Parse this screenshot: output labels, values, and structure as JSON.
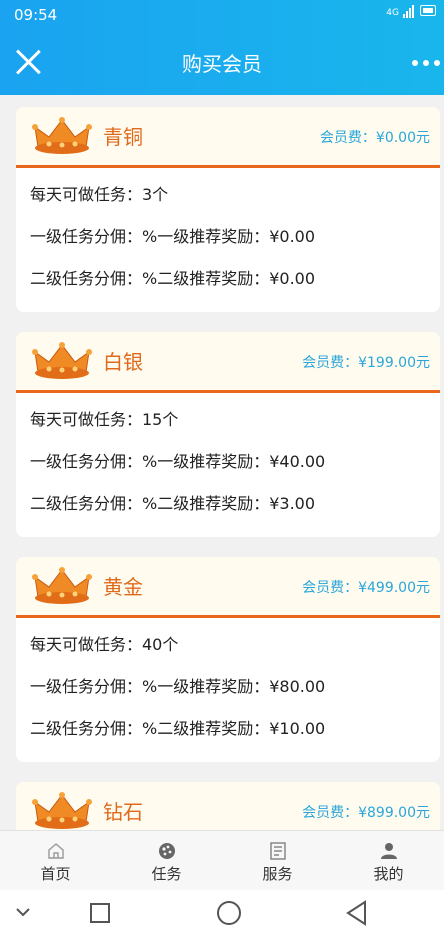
{
  "status_bar": {
    "time": "09:54",
    "network": "4G"
  },
  "header": {
    "title": "购买会员"
  },
  "tiers": [
    {
      "name": "青铜",
      "fee": "会员费：¥0.00元",
      "rows": [
        "每天可做任务：3个",
        "一级任务分佣：%一级推荐奖励：¥0.00",
        "二级任务分佣：%二级推荐奖励：¥0.00"
      ]
    },
    {
      "name": "白银",
      "fee": "会员费：¥199.00元",
      "rows": [
        "每天可做任务：15个",
        "一级任务分佣：%一级推荐奖励：¥40.00",
        "二级任务分佣：%二级推荐奖励：¥3.00"
      ]
    },
    {
      "name": "黄金",
      "fee": "会员费：¥499.00元",
      "rows": [
        "每天可做任务：40个",
        "一级任务分佣：%一级推荐奖励：¥80.00",
        "二级任务分佣：%二级推荐奖励：¥10.00"
      ]
    },
    {
      "name": "钻石",
      "fee": "会员费：¥899.00元",
      "rows": []
    }
  ],
  "tabbar": [
    {
      "label": "首页",
      "icon": "home-icon"
    },
    {
      "label": "任务",
      "icon": "task-icon"
    },
    {
      "label": "服务",
      "icon": "service-icon"
    },
    {
      "label": "我的",
      "icon": "user-icon"
    }
  ],
  "system_nav": {
    "icons": [
      "collapse-icon",
      "recents-icon",
      "home-circle-icon",
      "back-icon"
    ]
  },
  "colors": {
    "header": "#1aa3f0",
    "accent": "#e8671a",
    "fee": "#2ba6da"
  }
}
